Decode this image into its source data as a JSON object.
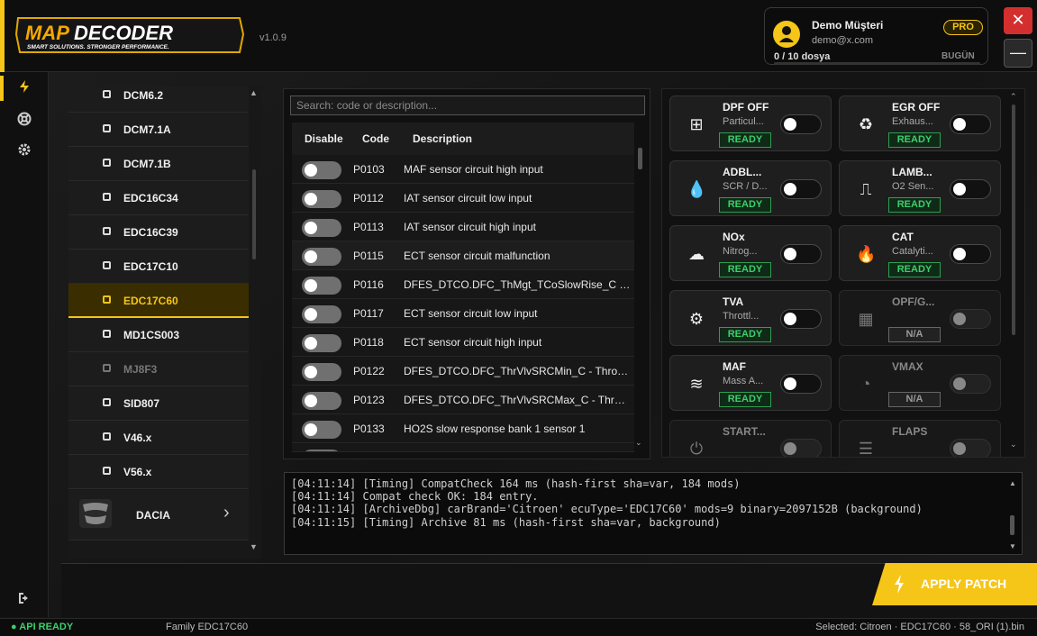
{
  "header": {
    "logo_text": "MAPDECODER",
    "logo_tagline": "SMART SOLUTIONS. STRONGER PERFORMANCE.",
    "version": "v1.0.9",
    "user": {
      "name": "Demo Müşteri",
      "email": "demo@x.com",
      "plan": "PRO",
      "usage": "0 / 10 dosya",
      "usage_fraction": 0,
      "period": "BUGÜN"
    },
    "close_label": "✕",
    "minimize_label": "—"
  },
  "rail": {
    "items": [
      {
        "icon": "bolt-icon",
        "active": true
      },
      {
        "icon": "lifebuoy-icon",
        "active": false
      },
      {
        "icon": "gear-icon",
        "active": false
      },
      {
        "icon": "logout-icon",
        "active": false
      }
    ]
  },
  "ecu_list": {
    "items": [
      {
        "name": "DCM6.2",
        "state": "normal"
      },
      {
        "name": "DCM7.1A",
        "state": "normal"
      },
      {
        "name": "DCM7.1B",
        "state": "normal"
      },
      {
        "name": "EDC16C34",
        "state": "normal"
      },
      {
        "name": "EDC16C39",
        "state": "normal"
      },
      {
        "name": "EDC17C10",
        "state": "normal"
      },
      {
        "name": "EDC17C60",
        "state": "selected"
      },
      {
        "name": "MD1CS003",
        "state": "normal"
      },
      {
        "name": "MJ8F3",
        "state": "disabled"
      },
      {
        "name": "SID807",
        "state": "normal"
      },
      {
        "name": "V46.x",
        "state": "normal"
      },
      {
        "name": "V56.x",
        "state": "normal"
      }
    ],
    "brand": {
      "name": "DACIA",
      "chevron": "›"
    }
  },
  "codes": {
    "search_placeholder": "Search: code or description...",
    "columns": {
      "disable": "Disable",
      "code": "Code",
      "description": "Description"
    },
    "rows": [
      {
        "code": "P0103",
        "description": "MAF sensor circuit high input"
      },
      {
        "code": "P0112",
        "description": "IAT sensor circuit low input"
      },
      {
        "code": "P0113",
        "description": "IAT sensor circuit high input"
      },
      {
        "code": "P0115",
        "description": "ECT sensor circuit malfunction"
      },
      {
        "code": "P0116",
        "description": "DFES_DTCO.DFC_ThMgt_TCoSlowRise_C - Engin..."
      },
      {
        "code": "P0117",
        "description": "ECT sensor circuit low input"
      },
      {
        "code": "P0118",
        "description": "ECT sensor circuit high input"
      },
      {
        "code": "P0122",
        "description": "DFES_DTCO.DFC_ThrVlvSRCMin_C - Throttle po..."
      },
      {
        "code": "P0123",
        "description": "DFES_DTCO.DFC_ThrVlvSRCMax_C - Throttle po..."
      },
      {
        "code": "P0133",
        "description": "HO2S slow response bank 1 sensor 1"
      }
    ]
  },
  "patches": [
    {
      "title": "DPF OFF",
      "sub": "Particul...",
      "badge": "READY",
      "icon": "grid-icon",
      "glyph": "⊞",
      "enabled": true
    },
    {
      "title": "EGR OFF",
      "sub": "Exhaus...",
      "badge": "READY",
      "icon": "recycle-icon",
      "glyph": "♻",
      "enabled": true
    },
    {
      "title": "ADBL...",
      "sub": "SCR / D...",
      "badge": "READY",
      "icon": "drop-icon",
      "glyph": "💧",
      "enabled": true
    },
    {
      "title": "LAMB...",
      "sub": "O2 Sen...",
      "badge": "READY",
      "icon": "wave-icon",
      "glyph": "⎍",
      "enabled": true
    },
    {
      "title": "NOx",
      "sub": "Nitrog...",
      "badge": "READY",
      "icon": "smog-icon",
      "glyph": "☁",
      "enabled": true
    },
    {
      "title": "CAT",
      "sub": "Catalyti...",
      "badge": "READY",
      "icon": "flame-icon",
      "glyph": "🔥",
      "enabled": true
    },
    {
      "title": "TVA",
      "sub": "Throttl...",
      "badge": "READY",
      "icon": "gears-icon",
      "glyph": "⚙",
      "enabled": true
    },
    {
      "title": "OPF/G...",
      "sub": "",
      "badge": "N/A",
      "icon": "grid-dots-icon",
      "glyph": "▦",
      "enabled": false
    },
    {
      "title": "MAF",
      "sub": "Mass A...",
      "badge": "READY",
      "icon": "wind-icon",
      "glyph": "≋",
      "enabled": true
    },
    {
      "title": "VMAX",
      "sub": "",
      "badge": "N/A",
      "icon": "gauge-icon",
      "glyph": "◔",
      "enabled": false
    },
    {
      "title": "START...",
      "sub": "",
      "badge": "",
      "icon": "power-icon",
      "glyph": "⏻",
      "enabled": false
    },
    {
      "title": "FLAPS",
      "sub": "",
      "badge": "",
      "icon": "sliders-icon",
      "glyph": "☰",
      "enabled": false
    }
  ],
  "log": [
    "[04:11:14] [Timing] CompatCheck 164 ms (hash-first sha=var, 184 mods)",
    "[04:11:14] Compat check OK: 184 entry.",
    "[04:11:14] [ArchiveDbg] carBrand='Citroen' ecuType='EDC17C60' mods=9 binary=2097152B (background)",
    "[04:11:15] [Timing] Archive 81 ms (hash-first sha=var, background)"
  ],
  "apply_label": "APPLY PATCH",
  "status": {
    "api": "● API READY",
    "family": "Family EDC17C60",
    "selected": "Selected: Citroen · EDC17C60 · 58_ORI (1).bin"
  },
  "colors": {
    "accent": "#f5c518",
    "ready": "#3ccf6a",
    "danger": "#d32f2f"
  }
}
